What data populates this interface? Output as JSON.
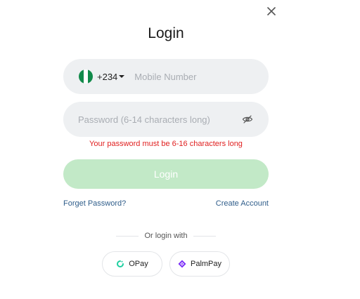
{
  "dialog": {
    "title": "Login",
    "close_icon": "close-icon"
  },
  "phone": {
    "flag_colors": [
      "#118a4a",
      "#ffffff",
      "#118a4a"
    ],
    "country_code": "+234",
    "placeholder": "Mobile Number"
  },
  "password": {
    "placeholder": "Password (6-14 characters long)",
    "visibility_icon": "eye-off-icon",
    "error": "Your password must be 6-16 characters long"
  },
  "login_button": {
    "label": "Login",
    "color": "#c2e9c7"
  },
  "links": {
    "forget_password": "Forget Password?",
    "create_account": "Create Account"
  },
  "social": {
    "divider_text": "Or login with",
    "providers": [
      {
        "label": "OPay",
        "icon": "opay-icon",
        "color": "#1dcfa0"
      },
      {
        "label": "PalmPay",
        "icon": "palmpay-icon",
        "color": "#7b2ff7"
      }
    ]
  },
  "colors": {
    "error": "#e02020",
    "link": "#2f5d8a",
    "field_bg": "#eef0f2"
  }
}
